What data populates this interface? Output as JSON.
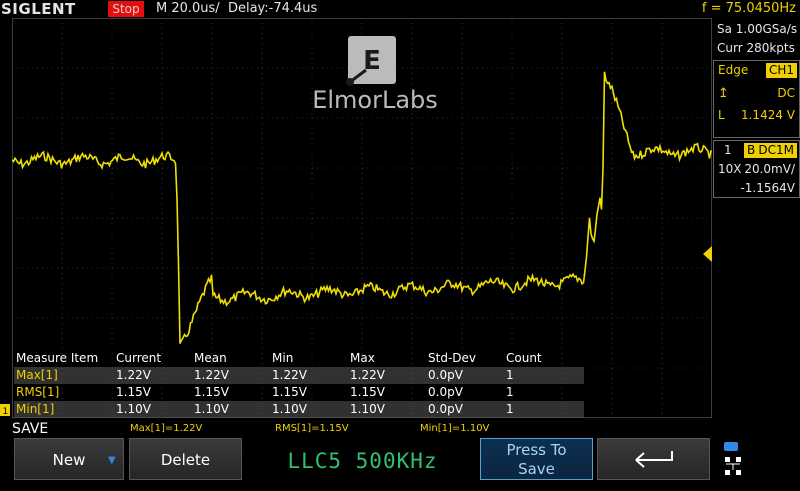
{
  "topbar": {
    "brand": "SIGLENT",
    "run_state": "Stop",
    "timebase": "M 20.0us/",
    "delay": "Delay:-74.4us",
    "frequency": "f = 75.0450Hz"
  },
  "watermark": {
    "text": "ElmorLabs"
  },
  "acquisition": {
    "sample_rate": "Sa 1.00GSa/s",
    "memory": "Curr 280kpts"
  },
  "trigger": {
    "type": "Edge",
    "source": "CH1",
    "coupling": "DC",
    "level_label": "L",
    "level": "1.1424 V"
  },
  "channel": {
    "number": "1",
    "bandwidth_flag": "B",
    "coupling": "DC1M",
    "probe": "10X",
    "scale": "20.0mV/",
    "offset": "-1.1564V"
  },
  "measure_table": {
    "headers": [
      "Measure Item",
      "Current",
      "Mean",
      "Min",
      "Max",
      "Std-Dev",
      "Count"
    ],
    "rows": [
      [
        "Max[1]",
        "1.22V",
        "1.22V",
        "1.22V",
        "1.22V",
        "0.0pV",
        "1"
      ],
      [
        "RMS[1]",
        "1.15V",
        "1.15V",
        "1.15V",
        "1.15V",
        "0.0pV",
        "1"
      ],
      [
        "Min[1]",
        "1.10V",
        "1.10V",
        "1.10V",
        "1.10V",
        "0.0pV",
        "1"
      ]
    ]
  },
  "status": {
    "save_label": "SAVE",
    "max": "Max[1]=1.22V",
    "rms": "RMS[1]=1.15V",
    "min": "Min[1]=1.10V"
  },
  "softkeys": {
    "new": "New",
    "delete": "Delete",
    "filename": "LLC5 500KHz",
    "press_line1": "Press To",
    "press_line2": "Save"
  },
  "colors": {
    "trace": "#f0e000",
    "stop": "#e01010",
    "text_value": "#30c070"
  }
}
